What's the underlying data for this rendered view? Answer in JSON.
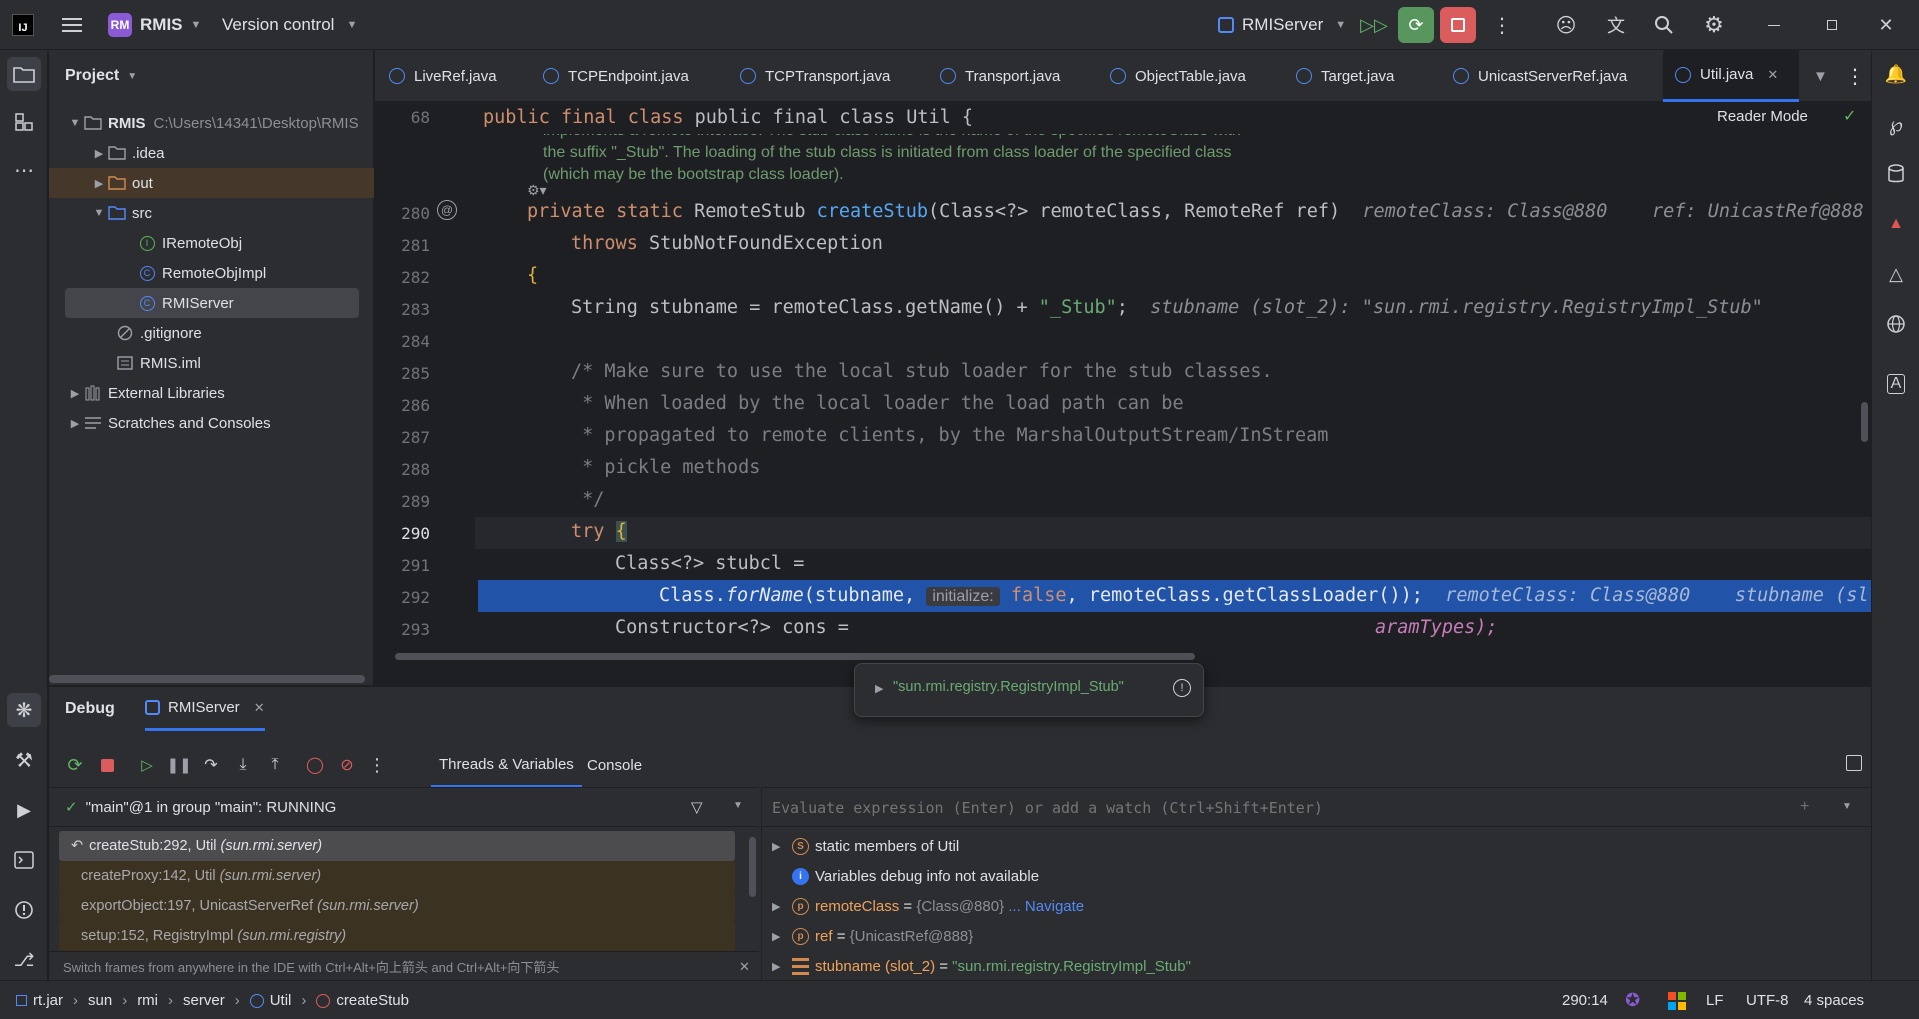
{
  "titlebar": {
    "project_badge": "RM",
    "project_name": "RMIS",
    "vcs_label": "Version control",
    "run_config": "RMIServer"
  },
  "project": {
    "title": "Project",
    "root_name": "RMIS",
    "root_path": "C:\\Users\\14341\\Desktop\\RMIS",
    "items": [
      {
        "label": ".idea"
      },
      {
        "label": "out"
      },
      {
        "label": "src"
      },
      {
        "label": "IRemoteObj"
      },
      {
        "label": "RemoteObjImpl"
      },
      {
        "label": "RMIServer"
      },
      {
        "label": ".gitignore"
      },
      {
        "label": "RMIS.iml"
      },
      {
        "label": "External Libraries"
      },
      {
        "label": "Scratches and Consoles"
      }
    ]
  },
  "tabs": [
    {
      "label": "LiveRef.java"
    },
    {
      "label": "TCPEndpoint.java"
    },
    {
      "label": "TCPTransport.java"
    },
    {
      "label": "Transport.java"
    },
    {
      "label": "ObjectTable.java"
    },
    {
      "label": "Target.java"
    },
    {
      "label": "UnicastServerRef.java"
    },
    {
      "label": "Util.java"
    }
  ],
  "editor": {
    "reader_mode": "Reader Mode",
    "sticky_line": "68",
    "sticky_code": "public final class Util {",
    "doc_lines": [
      "implements a remote interface. The stub class name is the name of the specified remoteClass with",
      "the suffix \"_Stub\". The loading of the stub class is initiated from class loader of the specified class",
      "(which may be the bootstrap class loader)."
    ],
    "line_numbers": [
      "280",
      "281",
      "282",
      "283",
      "284",
      "285",
      "286",
      "287",
      "288",
      "289",
      "290",
      "291",
      "292",
      "293"
    ],
    "hints": {
      "l280a": "remoteClass: Class@880",
      "l280b": "ref: UnicastRef@888",
      "l283": "stubname (slot_2): \"sun.rmi.registry.RegistryImpl_Stub\"",
      "l292a": "remoteClass: Class@880",
      "l292b": "stubname (sl",
      "initialize": "initialize:"
    },
    "code": {
      "l280_kw": "private static ",
      "l280_t": "RemoteStub ",
      "l280_fn": "createStub",
      "l280_rest": "(Class<?> remoteClass, RemoteRef ref)",
      "l281_kw": "throws ",
      "l281_rest": "StubNotFoundException",
      "l282": "{",
      "l283_a": "String stubname = remoteClass.getName() + ",
      "l283_str": "\"_Stub\"",
      "l283_b": ";",
      "l285": "/* Make sure to use the local stub loader for the stub classes.",
      "l286": " * When loaded by the local loader the load path can be",
      "l287": " * propagated to remote clients, by the MarshalOutputStream/InStream",
      "l288": " * pickle methods",
      "l289": " */",
      "l290_kw": "try ",
      "l290_b": "{",
      "l291": "Class<?> stubcl =",
      "l292_a": "Class.",
      "l292_fn": "forName",
      "l292_b": "(stubname, ",
      "l292_kw": "false",
      "l292_c": ", remoteClass.getClassLoader());",
      "l293_a": "Constructor<?> cons =",
      "l293_b": "aramTypes);"
    }
  },
  "tooltip": {
    "value": "\"sun.rmi.registry.RegistryImpl_Stub\""
  },
  "debug": {
    "title": "Debug",
    "session": "RMIServer",
    "tab_threads": "Threads & Variables",
    "tab_console": "Console",
    "thread": "\"main\"@1 in group \"main\": RUNNING",
    "frames": [
      {
        "method": "createStub:292, Util",
        "pkg": "(sun.rmi.server)"
      },
      {
        "method": "createProxy:142, Util",
        "pkg": "(sun.rmi.server)"
      },
      {
        "method": "exportObject:197, UnicastServerRef",
        "pkg": "(sun.rmi.server)"
      },
      {
        "method": "setup:152, RegistryImpl",
        "pkg": "(sun.rmi.registry)"
      }
    ],
    "hint": "Switch frames from anywhere in the IDE with Ctrl+Alt+向上箭头 and Ctrl+Alt+向下箭头",
    "eval_placeholder": "Evaluate expression (Enter) or add a watch (Ctrl+Shift+Enter)",
    "vars": {
      "static_kw": "static",
      "static_rest": "members of Util",
      "info": "Variables debug info not available",
      "remote_name": "remoteClass",
      "remote_val": "{Class@880}",
      "remote_link": "... Navigate",
      "ref_name": "ref",
      "ref_val": "{UnicastRef@888}",
      "stub_name": "stubname (slot_2)",
      "stub_val": "\"sun.rmi.registry.RegistryImpl_Stub\"",
      "eq": "="
    }
  },
  "status": {
    "crumbs": [
      "rt.jar",
      "sun",
      "rmi",
      "server",
      "Util",
      "createStub"
    ],
    "position": "290:14",
    "line_sep": "LF",
    "encoding": "UTF-8",
    "indent": "4 spaces"
  }
}
